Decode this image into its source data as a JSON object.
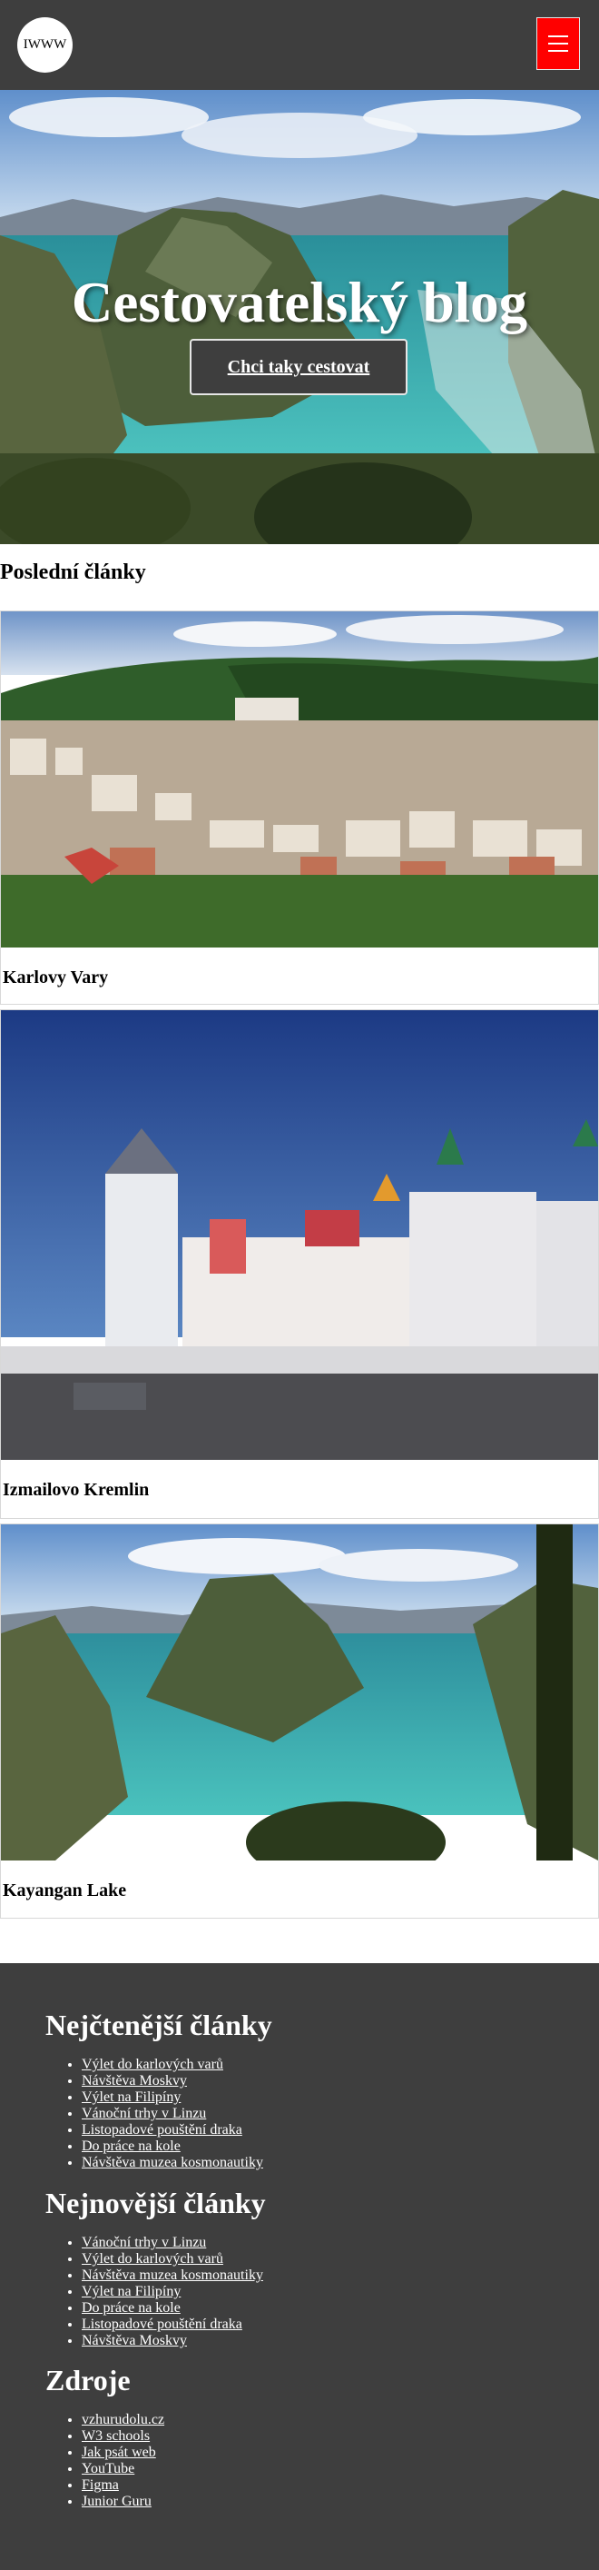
{
  "header": {
    "logo_text": "IWWW",
    "menu_icon": "hamburger-icon",
    "menu_color": "#ff0000",
    "background": "#3e3e3e"
  },
  "hero": {
    "title": "Cestovatelský blog",
    "button_label": "Chci taky cestovat"
  },
  "latest": {
    "title": "Poslední články",
    "articles": [
      {
        "caption": "Karlovy Vary",
        "image": "karlovy-vary-town-photo"
      },
      {
        "caption": "Izmailovo Kremlin",
        "image": "izmailovo-kremlin-photo"
      },
      {
        "caption": "Kayangan Lake",
        "image": "kayangan-lake-photo"
      }
    ]
  },
  "footer": {
    "most_read": {
      "title": "Nejčtenější články",
      "links": [
        "Výlet do karlových varů",
        "Návštěva Moskvy",
        "Výlet na Filipíny",
        "Vánoční trhy v Linzu",
        "Listopadové pouštění draka",
        "Do práce na kole",
        "Návštěva muzea kosmonautiky"
      ]
    },
    "newest": {
      "title": "Nejnovější články",
      "links": [
        "Vánoční trhy v Linzu",
        "Výlet do karlových varů",
        "Návštěva muzea kosmonautiky",
        "Výlet na Filipíny",
        "Do práce na kole",
        "Listopadové pouštění draka",
        "Návštěva Moskvy"
      ]
    },
    "sources": {
      "title": "Zdroje",
      "links": [
        "vzhurudolu.cz",
        "W3 schools",
        "Jak psát web",
        "YouTube",
        "Figma",
        "Junior Guru"
      ]
    }
  }
}
